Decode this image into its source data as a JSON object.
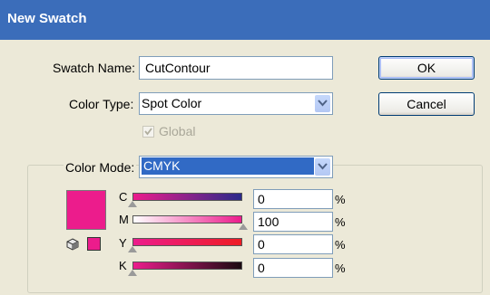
{
  "window": {
    "title": "New Swatch"
  },
  "form": {
    "swatch_name_label": "Swatch Name:",
    "swatch_name_value": "CutContour",
    "color_type_label": "Color Type:",
    "color_type_value": "Spot Color",
    "global_label": "Global",
    "global_checked": true,
    "color_mode_label": "Color Mode:",
    "color_mode_value": "CMYK"
  },
  "buttons": {
    "ok": "OK",
    "cancel": "Cancel"
  },
  "channels": [
    {
      "label": "C",
      "value": "0",
      "unit": "%"
    },
    {
      "label": "M",
      "value": "100",
      "unit": "%"
    },
    {
      "label": "Y",
      "value": "0",
      "unit": "%"
    },
    {
      "label": "K",
      "value": "0",
      "unit": "%"
    }
  ],
  "colors": {
    "swatch": "#ec1c8c",
    "title_bar": "#3b6dba",
    "mode_highlight": "#316ac5"
  },
  "icons": [
    "chevron-down-icon",
    "checkbox-icon",
    "cube-icon",
    "triangle-slider-icon"
  ]
}
